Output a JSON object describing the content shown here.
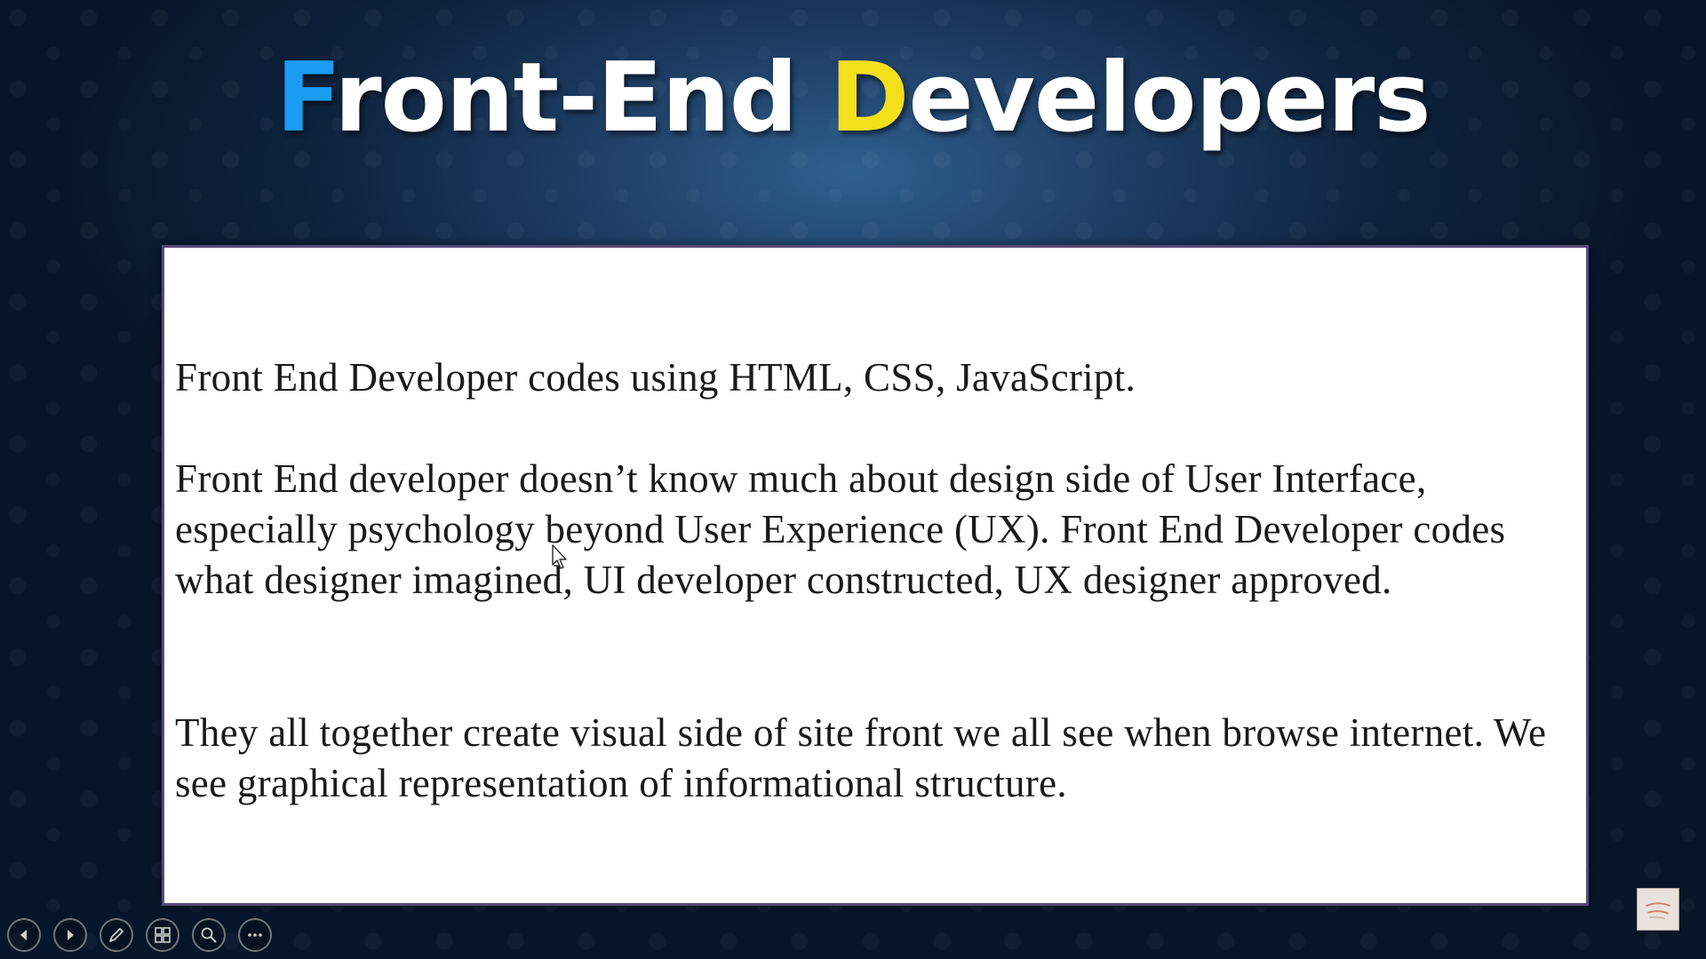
{
  "slide": {
    "title_first_initial": "F",
    "title_first_rest": "ront-End ",
    "title_second_initial": "D",
    "title_second_rest": "evelopers",
    "paragraphs": [
      "Front End Developer codes using HTML, CSS, JavaScript.",
      "Front End developer doesn’t know much about design side of User Interface, especially psychology beyond User Experience (UX). Front End Developer codes what designer imagined, UI developer constructed, UX designer approved.",
      "They all together create visual side of site front we all see when browse internet. We see graphical representation of informational structure."
    ]
  },
  "colors": {
    "title_initial_f": "#1a9cf0",
    "title_initial_d": "#f3e01a",
    "title_text": "#ffffff",
    "background": "#0f2440",
    "box_background": "#ffffff",
    "body_text": "#1a1a1a"
  },
  "controls": [
    {
      "icon": "previous-slide-icon"
    },
    {
      "icon": "next-slide-icon"
    },
    {
      "icon": "pen-icon"
    },
    {
      "icon": "slides-grid-icon"
    },
    {
      "icon": "zoom-icon"
    },
    {
      "icon": "more-options-icon"
    }
  ],
  "watermark": {
    "icon": "channel-logo-icon"
  }
}
